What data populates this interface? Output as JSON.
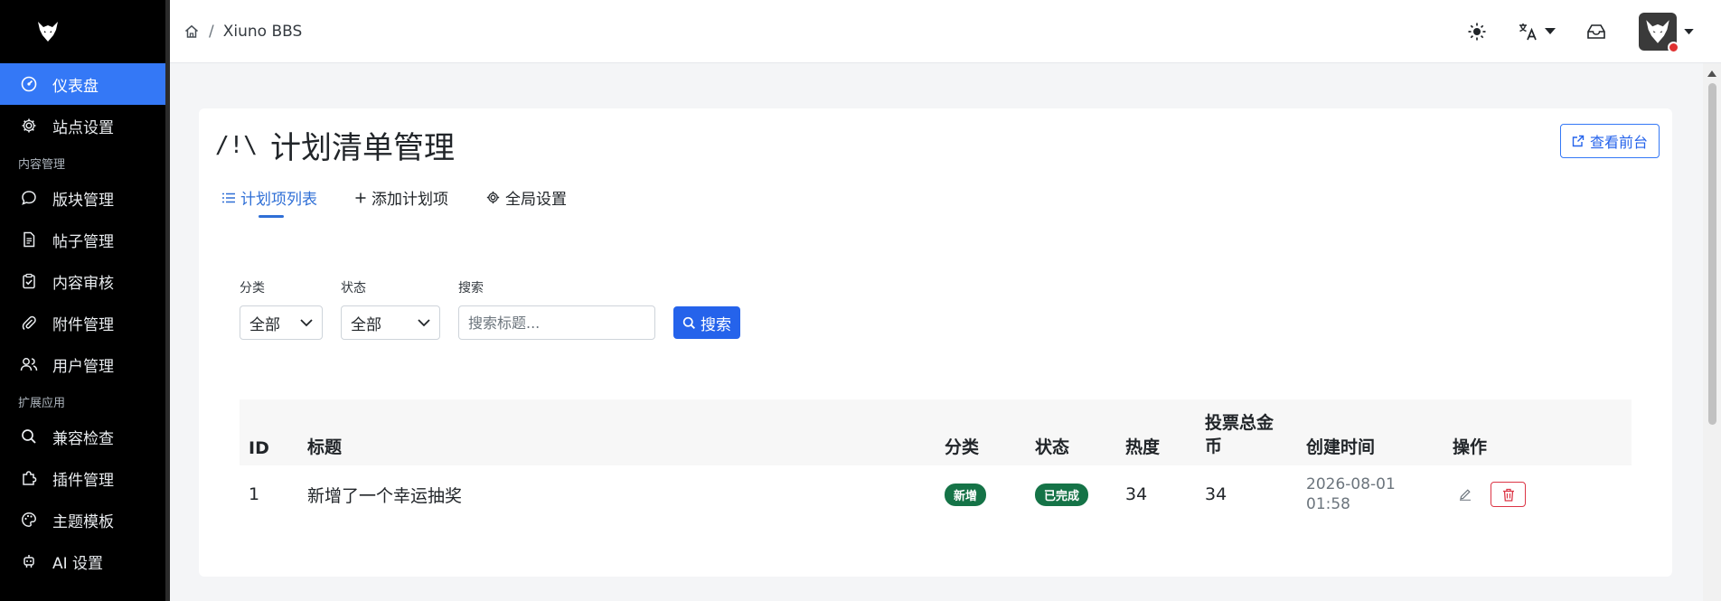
{
  "sidebar": {
    "items": [
      {
        "label": "仪表盘",
        "icon": "dashboard-icon",
        "active": true
      },
      {
        "label": "站点设置",
        "icon": "gear-icon"
      }
    ],
    "section_content": "内容管理",
    "content_items": [
      {
        "label": "版块管理",
        "icon": "chat-bubble-icon"
      },
      {
        "label": "帖子管理",
        "icon": "document-icon"
      },
      {
        "label": "内容审核",
        "icon": "clipboard-check-icon"
      },
      {
        "label": "附件管理",
        "icon": "paperclip-icon"
      },
      {
        "label": "用户管理",
        "icon": "users-icon"
      }
    ],
    "section_extend": "扩展应用",
    "extend_items": [
      {
        "label": "兼容检查",
        "icon": "search-icon"
      },
      {
        "label": "插件管理",
        "icon": "puzzle-icon"
      },
      {
        "label": "主题模板",
        "icon": "palette-icon"
      },
      {
        "label": "AI 设置",
        "icon": "robot-icon"
      }
    ]
  },
  "header": {
    "breadcrumb_sep": "/",
    "breadcrumb_site": "Xiuno BBS"
  },
  "page": {
    "title_mark": "/!\\",
    "title": "计划清单管理",
    "view_front_label": "查看前台",
    "tabs": [
      {
        "label": "计划项列表",
        "active": true
      },
      {
        "label": "添加计划项"
      },
      {
        "label": "全局设置"
      }
    ]
  },
  "filters": {
    "category_label": "分类",
    "category_value": "全部",
    "status_label": "状态",
    "status_value": "全部",
    "search_label": "搜索",
    "search_placeholder": "搜索标题...",
    "search_button": "搜索"
  },
  "table": {
    "headers": [
      "ID",
      "标题",
      "分类",
      "状态",
      "热度",
      "投票总金币",
      "创建时间",
      "操作"
    ],
    "rows": [
      {
        "id": "1",
        "title": "新增了一个幸运抽奖",
        "category": "新增",
        "status": "已完成",
        "heat": "34",
        "coins": "34",
        "created_date": "2026-08-01",
        "created_time": "01:58"
      }
    ]
  },
  "colors": {
    "primary": "#2563eb",
    "active_nav": "#3478f6",
    "badge_green": "#157347",
    "danger": "#dc3545"
  }
}
